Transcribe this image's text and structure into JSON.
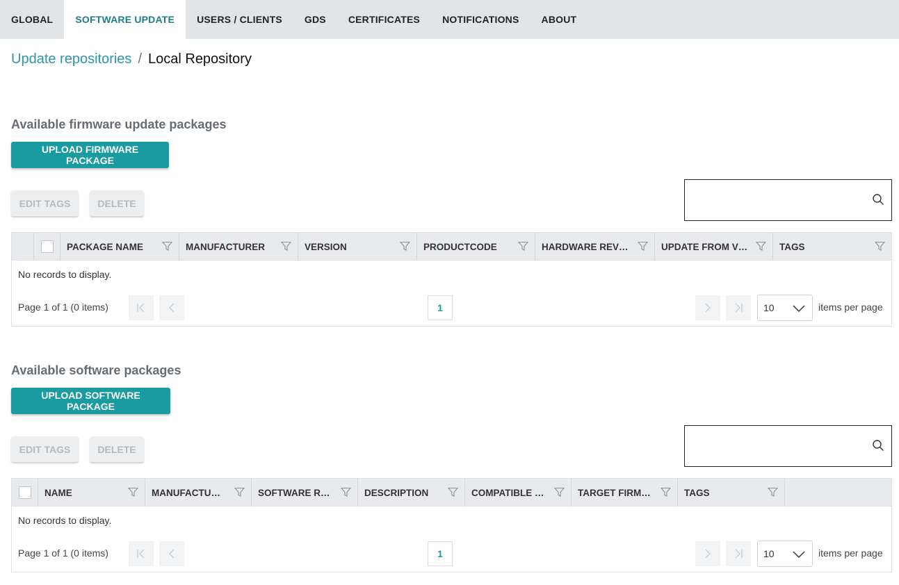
{
  "nav": {
    "tabs": [
      {
        "label": "GLOBAL"
      },
      {
        "label": "SOFTWARE UPDATE"
      },
      {
        "label": "USERS / CLIENTS"
      },
      {
        "label": "GDS"
      },
      {
        "label": "CERTIFICATES"
      },
      {
        "label": "NOTIFICATIONS"
      },
      {
        "label": "ABOUT"
      }
    ],
    "active_tab": "SOFTWARE UPDATE"
  },
  "breadcrumb": {
    "parent": "Update repositories",
    "separator": "/",
    "current": "Local Repository"
  },
  "colors": {
    "accent": "#1a9ba0",
    "link": "#2c95a8",
    "nav_bg": "#e2e5e8",
    "header_bg": "#e8eaed"
  },
  "firmware": {
    "title": "Available firmware update packages",
    "upload_label": "UPLOAD FIRMWARE PACKAGE",
    "edit_tags_label": "EDIT TAGS",
    "delete_label": "DELETE",
    "search": {
      "value": "",
      "placeholder": "",
      "icon": "search-icon"
    },
    "columns": [
      "PACKAGE NAME",
      "MANUFACTURER",
      "VERSION",
      "PRODUCTCODE",
      "HARDWARE REVISI…",
      "UPDATE FROM VER…",
      "TAGS"
    ],
    "empty_text": "No records to display.",
    "pager": {
      "info": "Page 1 of 1 (0 items)",
      "page": "1",
      "per_page": "10",
      "per_page_label": "items per page"
    }
  },
  "software": {
    "title": "Available software packages",
    "upload_label": "UPLOAD SOFTWARE PACKAGE",
    "edit_tags_label": "EDIT TAGS",
    "delete_label": "DELETE",
    "search": {
      "value": "",
      "placeholder": "",
      "icon": "search-icon"
    },
    "columns": [
      "NAME",
      "MANUFACTU…",
      "SOFTWARE R…",
      "DESCRIPTION",
      "COMPATIBLE TA…",
      "TARGET FIRM…",
      "TAGS"
    ],
    "empty_text": "No records to display.",
    "pager": {
      "info": "Page 1 of 1 (0 items)",
      "page": "1",
      "per_page": "10",
      "per_page_label": "items per page"
    }
  }
}
